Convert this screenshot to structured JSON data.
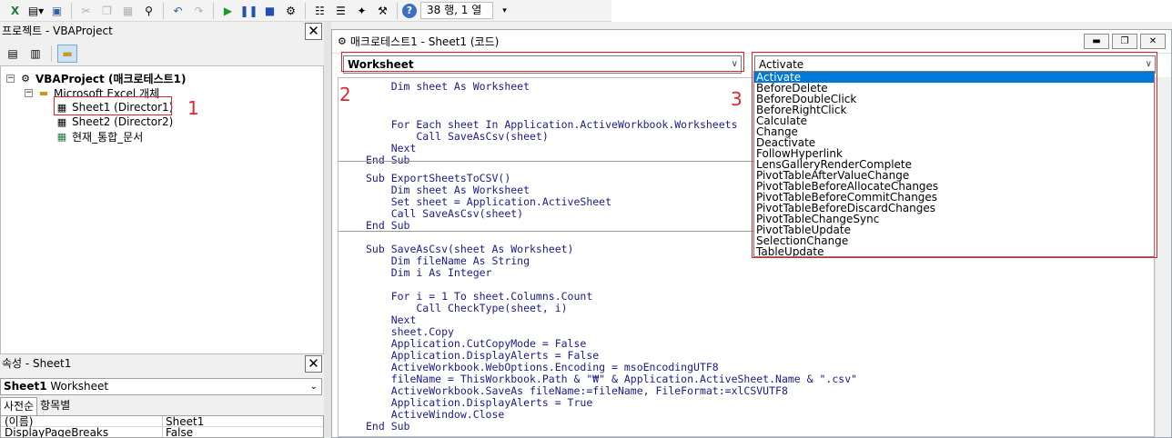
{
  "toolbar": {
    "status": "38 행, 1 열"
  },
  "project_pane": {
    "title": "프로젝트 - VBAProject",
    "tree": {
      "root": "VBAProject (매크로테스트1)",
      "folder": "Microsoft Excel 개체",
      "items": [
        "Sheet1 (Director1)",
        "Sheet2 (Director2)",
        "현재_통합_문서"
      ]
    }
  },
  "properties_pane": {
    "title": "속성 - Sheet1",
    "object_name": "Sheet1",
    "object_type": "Worksheet",
    "tabs": [
      "사전순",
      "항목별"
    ],
    "rows": [
      {
        "name": "(이름)",
        "value": "Sheet1"
      },
      {
        "name": "DisplayPageBreaks",
        "value": "False"
      }
    ]
  },
  "code_window": {
    "title": "매크로테스트1 - Sheet1 (코드)",
    "object_combo": "Worksheet",
    "proc_combo": "Activate",
    "lines": [
      "    Dim sheet As Worksheet",
      "",
      "",
      "    For Each sheet In Application.ActiveWorkbook.Worksheets",
      "        Call SaveAsCsv(sheet)",
      "    Next",
      "End Sub",
      "Sub ExportSheetsToCSV()",
      "    Dim sheet As Worksheet",
      "    Set sheet = Application.ActiveSheet",
      "    Call SaveAsCsv(sheet)",
      "End Sub",
      "Sub SaveAsCsv(sheet As Worksheet)",
      "    Dim fileName As String",
      "    Dim i As Integer",
      "",
      "    For i = 1 To sheet.Columns.Count",
      "        Call CheckType(sheet, i)",
      "    Next",
      "    sheet.Copy",
      "    Application.CutCopyMode = False",
      "    Application.DisplayAlerts = False",
      "    ActiveWorkbook.WebOptions.Encoding = msoEncodingUTF8",
      "    fileName = ThisWorkbook.Path & \"₩\" & Application.ActiveSheet.Name & \".csv\"",
      "    ActiveWorkbook.SaveAs fileName:=fileName, FileFormat:=xlCSVUTF8",
      "    Application.DisplayAlerts = True",
      "    ActiveWindow.Close",
      "End Sub"
    ]
  },
  "proc_dropdown": {
    "selected": "Activate",
    "items": [
      "Activate",
      "BeforeDelete",
      "BeforeDoubleClick",
      "BeforeRightClick",
      "Calculate",
      "Change",
      "Deactivate",
      "FollowHyperlink",
      "LensGalleryRenderComplete",
      "PivotTableAfterValueChange",
      "PivotTableBeforeAllocateChanges",
      "PivotTableBeforeCommitChanges",
      "PivotTableBeforeDiscardChanges",
      "PivotTableChangeSync",
      "PivotTableUpdate",
      "SelectionChange",
      "TableUpdate"
    ]
  },
  "annotations": [
    "1",
    "2",
    "3"
  ],
  "colors": {
    "accent": "#e0242c",
    "selection": "#0078d7",
    "code": "#1a1a8c"
  }
}
